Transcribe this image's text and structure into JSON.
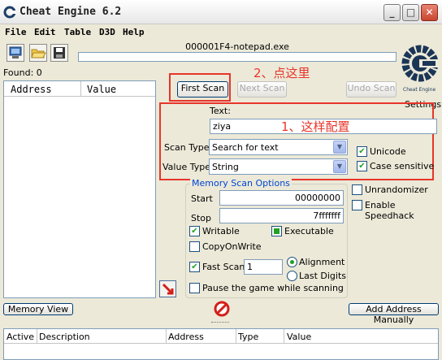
{
  "window": {
    "title": "Cheat Engine 6.2",
    "controls": [
      "_",
      "□",
      "✕"
    ]
  },
  "menu": [
    "File",
    "Edit",
    "Table",
    "D3D",
    "Help"
  ],
  "process_title": "000001F4-notepad.exe",
  "found_label": "Found: 0",
  "found_list": {
    "columns": [
      "Address",
      "Value"
    ]
  },
  "scan_buttons": {
    "first": "First Scan",
    "next": "Next Scan",
    "undo": "Undo Scan"
  },
  "settings_label": "Settings",
  "logo_caption": "Cheat Engine",
  "annotations": {
    "click_here": "2、点这里",
    "configure": "1、这样配置"
  },
  "text_label": "Text:",
  "text_value": "ziya",
  "scan_type": {
    "label": "Scan Type",
    "value": "Search for text"
  },
  "value_type": {
    "label": "Value Type",
    "value": "String"
  },
  "options": {
    "unicode": "Unicode",
    "case_sensitive": "Case sensitive",
    "unrandomizer": "Unrandomizer",
    "enable_speedhack": "Enable Speedhack"
  },
  "memory_scan": {
    "title": "Memory Scan Options",
    "start_label": "Start",
    "start_value": "00000000",
    "stop_label": "Stop",
    "stop_value": "7fffffff",
    "writable": "Writable",
    "executable": "Executable",
    "copy_on_write": "CopyOnWrite",
    "fast_scan": "Fast Scan",
    "fast_scan_value": "1",
    "alignment": "Alignment",
    "last_digits": "Last Digits",
    "pause_game": "Pause the game while scanning"
  },
  "bottom": {
    "memory_view": "Memory View",
    "add_address": "Add Address Manually",
    "columns": [
      "Active",
      "Description",
      "Address",
      "Type",
      "Value"
    ]
  },
  "colors": {
    "annotation": "#e8352a",
    "group_title": "#0046d5",
    "check": "#21a121"
  }
}
